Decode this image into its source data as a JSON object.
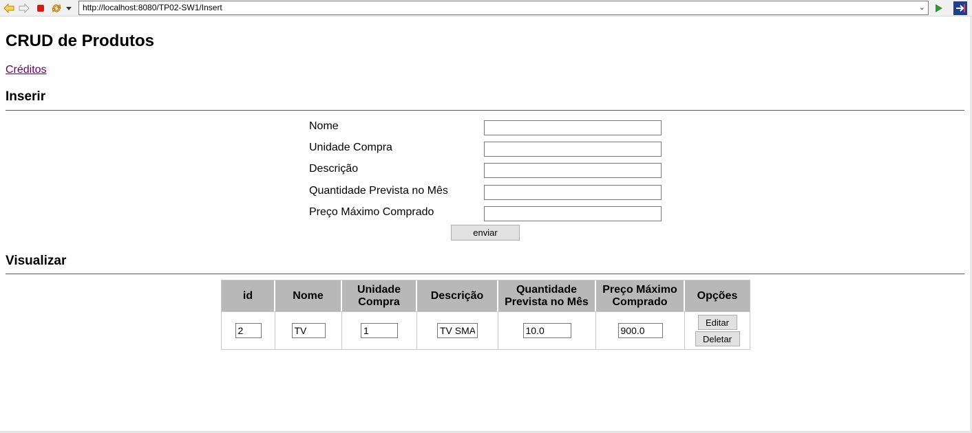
{
  "browser": {
    "url": "http://localhost:8080/TP02-SW1/Insert",
    "icons": [
      "back-icon",
      "forward-icon",
      "stop-icon",
      "refresh-icon",
      "dropdown-icon",
      "go-icon",
      "external-browser-icon"
    ]
  },
  "page": {
    "title": "CRUD de Produtos",
    "credits_link": "Créditos"
  },
  "insert": {
    "heading": "Inserir",
    "fields": [
      {
        "label": "Nome",
        "value": ""
      },
      {
        "label": "Unidade Compra",
        "value": ""
      },
      {
        "label": "Descrição",
        "value": ""
      },
      {
        "label": "Quantidade Prevista no Mês",
        "value": ""
      },
      {
        "label": "Preço Máximo Comprado",
        "value": ""
      }
    ],
    "submit_label": "enviar"
  },
  "view": {
    "heading": "Visualizar",
    "columns": [
      "id",
      "Nome",
      "Unidade Compra",
      "Descrição",
      "Quantidade Prevista no Mês",
      "Preço Máximo Comprado",
      "Opções"
    ],
    "rows": [
      {
        "id": "2",
        "nome": "TV",
        "unidade": "1",
        "descricao": "TV SMART",
        "quantidade": "10.0",
        "preco": "900.0"
      }
    ],
    "edit_label": "Editar",
    "delete_label": "Deletar"
  },
  "colors": {
    "link_visited": "#660066",
    "table_header_bg": "#b8b8b8",
    "go_green": "#2e9a2e",
    "stop_red": "#d11c1c"
  }
}
